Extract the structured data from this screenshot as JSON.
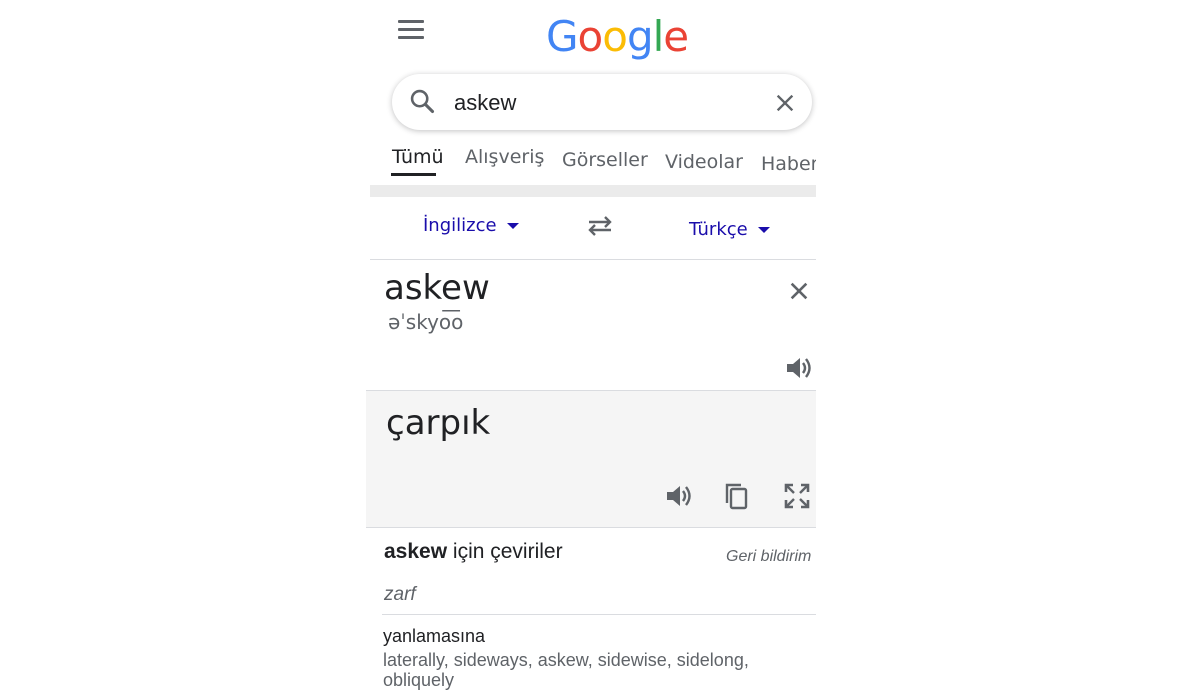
{
  "header": {
    "logo_letters": [
      {
        "char": "G",
        "color": "#4285F4"
      },
      {
        "char": "o",
        "color": "#EA4335"
      },
      {
        "char": "o",
        "color": "#FBBC05"
      },
      {
        "char": "g",
        "color": "#4285F4"
      },
      {
        "char": "l",
        "color": "#34A853"
      },
      {
        "char": "e",
        "color": "#EA4335"
      }
    ],
    "menu_icon": "hamburger-menu-icon"
  },
  "search": {
    "value": "askew",
    "search_icon": "search-icon",
    "clear_icon": "close-icon"
  },
  "tabs": [
    {
      "label": "Tümü",
      "active": true
    },
    {
      "label": "Alışveriş",
      "active": false
    },
    {
      "label": "Görseller",
      "active": false
    },
    {
      "label": "Videolar",
      "active": false
    },
    {
      "label": "Haberler",
      "active": false
    }
  ],
  "translator": {
    "source_lang": "İngilizce",
    "target_lang": "Türkçe",
    "source_text": "askew",
    "phonetic": "əˈskyo͞o",
    "target_text": "çarpık"
  },
  "translations": {
    "heading_word": "askew",
    "heading_rest": "için çeviriler",
    "feedback": "Geri bildirim",
    "part_of_speech": "zarf",
    "word": "yanlamasına",
    "synonyms_line1": "laterally,  sideways,  askew,  sidewise,  sidelong,",
    "synonyms_line2": "obliquely"
  },
  "colors": {
    "link_blue": "#1a0dab",
    "muted": "#5f6368",
    "divider": "#dadce0"
  }
}
